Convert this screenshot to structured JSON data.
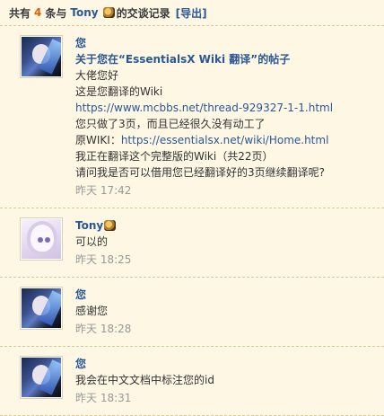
{
  "header": {
    "prefix": "共有",
    "count": "4",
    "middle": "条与",
    "user": "Tony",
    "suffix": "的交谈记录",
    "export_label": "[导出]"
  },
  "messages": [
    {
      "sender": "您",
      "subject": "关于您在“EssentialsX Wiki 翻译”的帖子",
      "lines": [
        {
          "text": "大佬您好"
        },
        {
          "text": "这是您翻译的Wiki"
        },
        {
          "link": "https://www.mcbbs.net/thread-929327-1-1.html"
        },
        {
          "text": "您只做了3页，而且已经很久没有动工了"
        },
        {
          "prefix": "原WIKI：",
          "link": "https://essentialsx.net/wiki/Home.html"
        },
        {
          "text": "我正在翻译这个完整版的Wiki（共22页）"
        },
        {
          "text": "请问我是否可以借用您已经翻译好的3页继续翻译呢?"
        }
      ],
      "time": "昨天 17:42"
    },
    {
      "sender": "Tony",
      "lines": [
        {
          "text": "可以的"
        }
      ],
      "time": "昨天 18:25"
    },
    {
      "sender": "您",
      "lines": [
        {
          "text": "感谢您"
        }
      ],
      "time": "昨天 18:28"
    },
    {
      "sender": "您",
      "lines": [
        {
          "text": "我会在中文文档中标注您的id"
        }
      ],
      "time": "昨天 18:31"
    }
  ]
}
